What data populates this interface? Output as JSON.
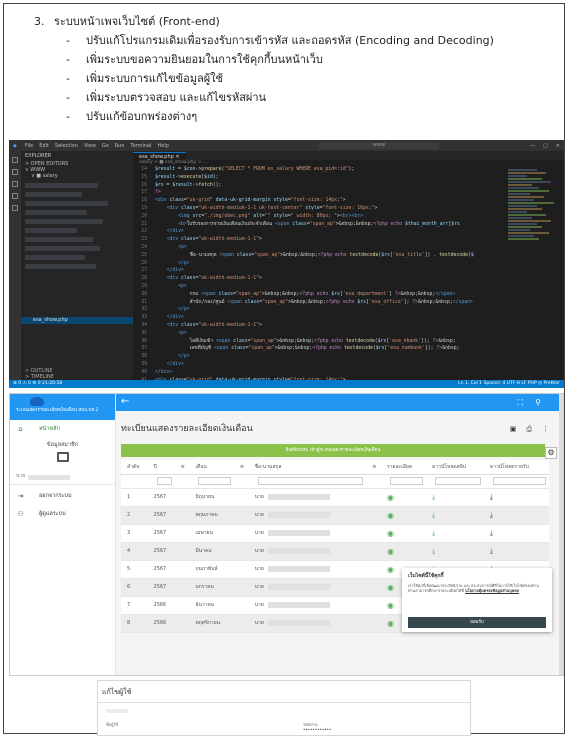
{
  "doc": {
    "heading_number": "3.",
    "heading": "ระบบหน้าเพจเว็บไซต์ (Front-end)",
    "bullets": [
      "ปรับแก้โปรแกรมเดิมเพื่อรองรับการเข้ารหัส และถอดรหัส (Encoding and Decoding)",
      "เพิ่มระบบขอความยินยอมในการใช้คุกกี้บนหน้าเว็บ",
      "เพิ่มระบบการแก้ไขข้อมูลผู้ใช้",
      "เพิ่มระบบตรวจสอบ และแก้ไขรหัสผ่าน",
      "ปรับแก้ข้อบกพร่องต่างๆ"
    ]
  },
  "ide": {
    "menu": [
      "File",
      "Edit",
      "Selection",
      "View",
      "Go",
      "Run",
      "Terminal",
      "Help"
    ],
    "command_center": "www",
    "window_controls": [
      "—",
      "▢",
      "✕"
    ],
    "explorer_title": "EXPLORER",
    "open_editors": "> OPEN EDITORS",
    "workspace": "∨ WWW",
    "folder": "∨ ■ salary",
    "active_file": "esa_show.php",
    "outline": "> OUTLINE",
    "timeline": "> TIMELINE",
    "tab": "esa_show.php  ✕",
    "breadcrumb": "salary > ■ esa_show.php > ...",
    "code_lines": [
      {
        "n": "14",
        "html": "<span class=\"v\">$result</span> = <span class=\"v\">$con</span>-><span class=\"f\">prepare</span>(<span class=\"s\">\"SELECT * FROM es_salary WHERE esa_pid=:id\"</span>);"
      },
      {
        "n": "15",
        "html": "<span class=\"v\">$result</span>-><span class=\"f\">execute</span>(<span class=\"v\">$id</span>);"
      },
      {
        "n": "16",
        "html": "<span class=\"v\">$rs</span> = <span class=\"v\">$result</span>-><span class=\"f\">fetch</span>();"
      },
      {
        "n": "17",
        "html": "<span class=\"p\">?></span>"
      },
      {
        "n": "18",
        "html": "<span class=\"k\">&lt;div</span> <span class=\"v\">class</span>=<span class=\"s\">\"uk-grid\"</span> <span class=\"v\">data-uk-grid-margin</span> <span class=\"v\">style</span>=<span class=\"s\">\"font-size: 14px;\"</span>>"
      },
      {
        "n": "19",
        "html": "    <span class=\"k\">&lt;div</span> <span class=\"v\">class</span>=<span class=\"s\">\"uk-width-medium-1-1 uk-text-center\"</span> <span class=\"v\">style</span>=<span class=\"s\">\"font-size: 16px;\"</span>>"
      },
      {
        "n": "20",
        "html": "        <span class=\"k\">&lt;img</span> <span class=\"v\">src</span>=<span class=\"s\">\"./img/obec.png\"</span> <span class=\"v\">alt</span>=<span class=\"s\">\"\"</span> <span class=\"v\">style</span>=<span class=\"s\">\" width: 80px; \"</span>><span class=\"k\">&lt;br>&lt;br></span>"
      },
      {
        "n": "21",
        "html": "        <span class=\"k\">&lt;b></span>ใบรับรองการจ่ายเงินเดือนเงินประจำเดือน <span class=\"k\">&lt;span</span> <span class=\"v\">class</span>=<span class=\"s\">\"span_ap\"</span>>&amp;nbsp;&amp;nbsp;<span class=\"p\">&lt;?php echo</span> <span class=\"v\">$thai_month_arr</span>[<span class=\"v\">$rs</span>"
      },
      {
        "n": "22",
        "html": "    <span class=\"k\">&lt;/div></span>"
      },
      {
        "n": "23",
        "html": "    <span class=\"k\">&lt;div</span> <span class=\"v\">class</span>=<span class=\"s\">\"uk-width-medium-1-1\"</span>>"
      },
      {
        "n": "24",
        "html": "        <span class=\"k\">&lt;p></span>"
      },
      {
        "n": "25",
        "html": "            ชื่อ-นามสกุล <span class=\"k\">&lt;span</span> <span class=\"v\">class</span>=<span class=\"s\">\"span_ap\"</span>>&amp;nbsp;&amp;nbsp;<span class=\"p\">&lt;?php echo</span> <span class=\"f\">testdecode</span>(<span class=\"v\">$rs</span>[<span class=\"s\">'esa_title'</span>]) . <span class=\"f\">testdecode</span>(<span class=\"v\">$</span>"
      },
      {
        "n": "26",
        "html": "        <span class=\"k\">&lt;/p></span>"
      },
      {
        "n": "27",
        "html": "    <span class=\"k\">&lt;/div></span>"
      },
      {
        "n": "28",
        "html": "    <span class=\"k\">&lt;div</span> <span class=\"v\">class</span>=<span class=\"s\">\"uk-width-medium-1-1\"</span>>"
      },
      {
        "n": "29",
        "html": "        <span class=\"k\">&lt;p></span>"
      },
      {
        "n": "30",
        "html": "            กรม <span class=\"k\">&lt;span</span> <span class=\"v\">class</span>=<span class=\"s\">\"span_ap\"</span>>&amp;nbsp;&amp;nbsp;<span class=\"p\">&lt;?php echo</span> <span class=\"v\">$rs</span>[<span class=\"s\">'esa_department'</span>] <span class=\"p\">?></span>&amp;nbsp;&amp;nbsp;<span class=\"k\">&lt;/span></span>"
      },
      {
        "n": "31",
        "html": "            สำนัก/กอง/ศูนย์ <span class=\"k\">&lt;span</span> <span class=\"v\">class</span>=<span class=\"s\">\"span_ap\"</span>>&amp;nbsp;&amp;nbsp;<span class=\"p\">&lt;?php echo</span> <span class=\"v\">$rs</span>[<span class=\"s\">'esa_office'</span>]; <span class=\"p\">?></span>&amp;nbsp;&amp;nbsp;<span class=\"k\">&lt;/span></span>"
      },
      {
        "n": "32",
        "html": "        <span class=\"k\">&lt;/p></span>"
      },
      {
        "n": "33",
        "html": "    <span class=\"k\">&lt;/div></span>"
      },
      {
        "n": "34",
        "html": "    <span class=\"k\">&lt;div</span> <span class=\"v\">class</span>=<span class=\"s\">\"uk-width-medium-1-1\"</span>>"
      },
      {
        "n": "35",
        "html": "        <span class=\"k\">&lt;p></span>"
      },
      {
        "n": "36",
        "html": "            ไอดีเงินเข้า <span class=\"k\">&lt;span</span> <span class=\"v\">class</span>=<span class=\"s\">\"span_ap\"</span>>&amp;nbsp;&amp;nbsp;<span class=\"p\">&lt;?php echo</span> <span class=\"f\">testdecode</span>(<span class=\"v\">$rs</span>[<span class=\"s\">'esa_nbank'</span>]); <span class=\"p\">?></span>&amp;nbsp;"
      },
      {
        "n": "37",
        "html": "            เลขที่บัญชี <span class=\"k\">&lt;span</span> <span class=\"v\">class</span>=<span class=\"s\">\"span_ap\"</span>>&amp;nbsp;&amp;nbsp;<span class=\"p\">&lt;?php echo</span> <span class=\"f\">testdecode</span>(<span class=\"v\">$rs</span>[<span class=\"s\">'esa_numbank'</span>]); <span class=\"p\">?></span>&amp;nbsp;"
      },
      {
        "n": "38",
        "html": "        <span class=\"k\">&lt;/p></span>"
      },
      {
        "n": "39",
        "html": "    <span class=\"k\">&lt;/div></span>"
      },
      {
        "n": "40",
        "html": "<span class=\"k\">&lt;/div></span>"
      },
      {
        "n": "41",
        "html": "<span class=\"k\">&lt;div</span> <span class=\"v\">class</span>=<span class=\"s\">\"uk-grid\"</span> <span class=\"v\">data-uk-grid-margin</span> <span class=\"v\">style</span>=<span class=\"s\">\"font-size: 14px;\"</span>>"
      },
      {
        "n": "42",
        "html": "    <span class=\"k\">&lt;div</span> <span class=\"v\">class</span>=<span class=\"s\">\"uk-width-medium-1-2\"</span>>"
      }
    ],
    "status_left": "⊗ 0 ⚠ 0   ⚙ 0   21:20:58",
    "status_right": "Ln 1, Col 1   Spaces: 4   UTF-8   LF   PHP   ◎ Prettier"
  },
  "web": {
    "sidebar_org": "ระบบแสดงรายละเอียดเงินเดือน สพป.ปท.2",
    "home": "หน้าหลัก",
    "user_label": "ข้อมูลสมาชิก",
    "user_prefix": "นาย",
    "logout": "ออกจากระบบ",
    "admin": "ผู้ดูแลระบบ",
    "page_title": "ทะเบียนแสดงรายละเอียดเงินเดือน",
    "banner": "ยินดีต้อนรับ เข้าสู่ระบบแสดงรายละเอียดเงินเดือน",
    "columns": [
      "ลำดับ",
      "ปี",
      "≡",
      "เดือน",
      "≡",
      "ชื่อ-นามสกุล",
      "≡",
      "รายละเอียด",
      "ดาวน์โหลดสลิป",
      "ดาวน์โหลดรายรับ"
    ],
    "rows": [
      {
        "no": "1",
        "year": "2567",
        "month": "มิถุนายน",
        "name": "นาย"
      },
      {
        "no": "2",
        "year": "2567",
        "month": "พฤษภาคม",
        "name": "นาย"
      },
      {
        "no": "3",
        "year": "2567",
        "month": "เมษายน",
        "name": "นาย"
      },
      {
        "no": "4",
        "year": "2567",
        "month": "มีนาคม",
        "name": "นาย"
      },
      {
        "no": "5",
        "year": "2567",
        "month": "กุมภาพันธ์",
        "name": "นาย"
      },
      {
        "no": "6",
        "year": "2567",
        "month": "มกราคม",
        "name": "นาย"
      },
      {
        "no": "7",
        "year": "2566",
        "month": "ธันวาคม",
        "name": "นาย"
      },
      {
        "no": "8",
        "year": "2566",
        "month": "พฤศจิกายน",
        "name": "นาย"
      }
    ],
    "cookie": {
      "title": "เว็บไซต์นี้ใช้คุกกี้",
      "body": "เราใช้คุกกี้เพื่อพัฒนาประสิทธิภาพ และประสบการณ์ที่ดีในการใช้เว็บไซต์ของท่าน ท่านสามารถศึกษารายละเอียดได้ที่",
      "link": "นโยบายคุ้มครองข้อมูลส่วนบุคคล",
      "accept": "ยอมรับ"
    },
    "accent": "#2196f3",
    "banner_color": "#8bc34a"
  },
  "edit": {
    "title": "แก้ไขผู้ใช้",
    "username_label": "ชื่อผู้ใช้",
    "password_label": "รหัสผ่าน",
    "password_value": "••••••••••••"
  }
}
